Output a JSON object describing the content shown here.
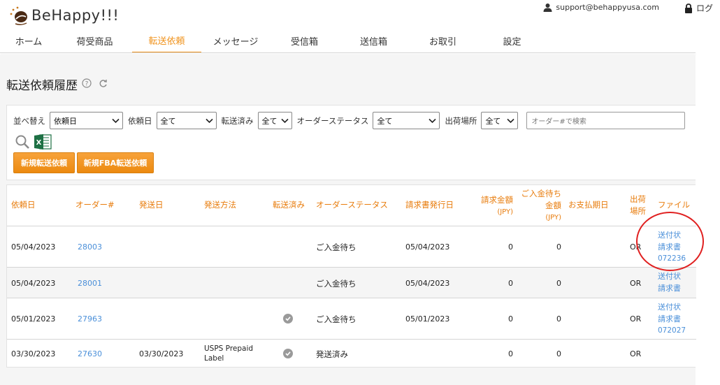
{
  "brand": {
    "name": "BeHappy!!!"
  },
  "account": {
    "email": "support@behappyusa.com",
    "logout_label": "ログ"
  },
  "nav": {
    "items": [
      {
        "label": "ホーム",
        "active": false
      },
      {
        "label": "荷受商品",
        "active": false
      },
      {
        "label": "転送依頼",
        "active": true
      },
      {
        "label": "メッセージ",
        "active": false
      },
      {
        "label": "受信箱",
        "active": false
      },
      {
        "label": "送信箱",
        "active": false
      },
      {
        "label": "お取引",
        "active": false
      },
      {
        "label": "設定",
        "active": false
      }
    ]
  },
  "page": {
    "title": "転送依頼履歴"
  },
  "filters": {
    "sort_label": "並べ替え",
    "sort_value": "依頼日",
    "date_label": "依頼日",
    "date_value": "全て",
    "forwarded_label": "転送済み",
    "forwarded_value": "全て",
    "status_label": "オーダーステータス",
    "status_value": "全て",
    "location_label": "出荷場所",
    "location_value": "全て",
    "search_placeholder": "オーダー#で検索"
  },
  "buttons": {
    "new_forward": "新規転送依頼",
    "new_fba_forward": "新規FBA転送依頼"
  },
  "table": {
    "headers": {
      "request_date": "依頼日",
      "order_no": "オーダー#",
      "ship_date": "発送日",
      "ship_method": "発送方法",
      "forwarded": "転送済み",
      "order_status": "オーダーステータス",
      "invoice_date": "請求書発行日",
      "invoice_amount_1": "請求金額",
      "invoice_amount_2": "(JPY)",
      "pending_1": "ご入金待ち",
      "pending_2": "金額",
      "pending_3": "(JPY)",
      "due_date": "お支払期日",
      "location_1": "出荷",
      "location_2": "場所",
      "files": "ファイル"
    },
    "rows": [
      {
        "request_date": "05/04/2023",
        "order_no": "28003",
        "ship_date": "",
        "ship_method_1": "",
        "ship_method_2": "",
        "forwarded": false,
        "status": "ご入金待ち",
        "invoice_date": "05/04/2023",
        "amount": "0",
        "pending": "0",
        "due_date": "",
        "location": "OR",
        "file_1": "送付状",
        "file_2": "請求書",
        "file_3": "072236"
      },
      {
        "request_date": "05/04/2023",
        "order_no": "28001",
        "ship_date": "",
        "ship_method_1": "",
        "ship_method_2": "",
        "forwarded": false,
        "status": "ご入金待ち",
        "invoice_date": "05/04/2023",
        "amount": "0",
        "pending": "0",
        "due_date": "",
        "location": "OR",
        "file_1": "送付状",
        "file_2": "請求書",
        "file_3": ""
      },
      {
        "request_date": "05/01/2023",
        "order_no": "27963",
        "ship_date": "",
        "ship_method_1": "",
        "ship_method_2": "",
        "forwarded": true,
        "status": "ご入金待ち",
        "invoice_date": "05/01/2023",
        "amount": "0",
        "pending": "0",
        "due_date": "",
        "location": "OR",
        "file_1": "送付状",
        "file_2": "請求書",
        "file_3": "072027"
      },
      {
        "request_date": "03/30/2023",
        "order_no": "27630",
        "ship_date": "03/30/2023",
        "ship_method_1": "USPS Prepaid",
        "ship_method_2": "Label",
        "forwarded": true,
        "status": "発送済み",
        "invoice_date": "",
        "amount": "0",
        "pending": "0",
        "due_date": "",
        "location": "OR",
        "file_1": "",
        "file_2": "",
        "file_3": ""
      }
    ]
  },
  "colors": {
    "accent": "#f0931d",
    "link": "#4a8fd9",
    "annotation": "#e02020"
  }
}
